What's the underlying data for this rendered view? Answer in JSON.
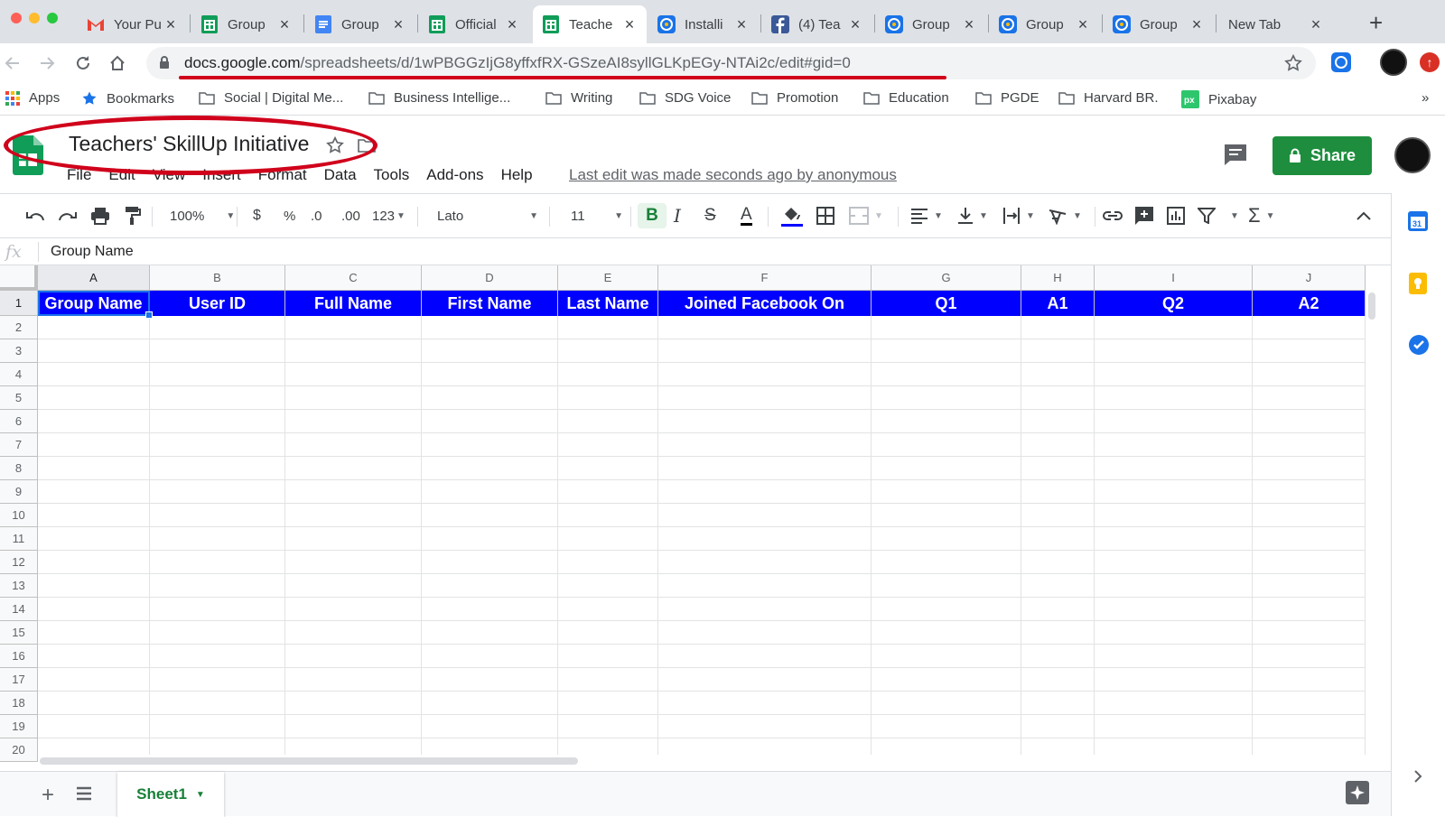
{
  "browser": {
    "tabs": [
      {
        "title": "Your Pu",
        "icon": "gmail-icon"
      },
      {
        "title": "Group",
        "icon": "sheets-icon"
      },
      {
        "title": "Group",
        "icon": "docs-icon"
      },
      {
        "title": "Official",
        "icon": "sheets-icon"
      },
      {
        "title": "Teache",
        "icon": "sheets-icon",
        "active": true
      },
      {
        "title": "Installi",
        "icon": "extension-icon"
      },
      {
        "title": "(4) Tea",
        "icon": "facebook-icon"
      },
      {
        "title": "Group",
        "icon": "extension-icon"
      },
      {
        "title": "Group",
        "icon": "extension-icon"
      },
      {
        "title": "Group",
        "icon": "extension-icon"
      },
      {
        "title": "New Tab",
        "icon": "none"
      }
    ],
    "url_domain": "docs.google.com",
    "url_path": "/spreadsheets/d/1wPBGGzIjG8yffxfRX-GSzeAI8syllGLKpEGy-NTAi2c/edit#gid=0",
    "bookmarks": [
      {
        "label": "Apps",
        "icon": "apps-grid-icon"
      },
      {
        "label": "Bookmarks",
        "icon": "star-icon"
      },
      {
        "label": "Social | Digital Me...",
        "icon": "folder-icon"
      },
      {
        "label": "Business Intellige...",
        "icon": "folder-icon"
      },
      {
        "label": "Writing",
        "icon": "folder-icon"
      },
      {
        "label": "SDG Voice",
        "icon": "folder-icon"
      },
      {
        "label": "Promotion",
        "icon": "folder-icon"
      },
      {
        "label": "Education",
        "icon": "folder-icon"
      },
      {
        "label": "PGDE",
        "icon": "folder-icon"
      },
      {
        "label": "Harvard BR.",
        "icon": "folder-icon"
      },
      {
        "label": "Pixabay",
        "icon": "pixabay-icon"
      }
    ],
    "more_bookmarks": "»"
  },
  "sheets": {
    "doc_title": "Teachers' SkillUp Initiative",
    "menu": [
      "File",
      "Edit",
      "View",
      "Insert",
      "Format",
      "Data",
      "Tools",
      "Add-ons",
      "Help"
    ],
    "last_edit": "Last edit was made seconds ago by anonymous",
    "share_label": "Share",
    "toolbar": {
      "zoom": "100%",
      "currency": "$",
      "percent": "%",
      "dec_decrease": ".0",
      "dec_increase": ".00",
      "more_formats": "123",
      "font": "Lato",
      "font_size": "11"
    },
    "formula_bar": {
      "fx": "fx",
      "value": "Group Name"
    },
    "columns": [
      "A",
      "B",
      "C",
      "D",
      "E",
      "F",
      "G",
      "H",
      "I",
      "J"
    ],
    "rows": [
      "1",
      "2",
      "3",
      "4",
      "5",
      "6",
      "7",
      "8",
      "9",
      "10",
      "11",
      "12",
      "13",
      "14",
      "15",
      "16",
      "17",
      "18",
      "19",
      "20"
    ],
    "header_row": [
      "Group Name",
      "User ID",
      "Full Name",
      "First Name",
      "Last Name",
      "Joined Facebook On",
      "Q1",
      "A1",
      "Q2",
      "A2"
    ],
    "header_fill": "#0000ff",
    "sheet_tab": "Sheet1",
    "accent": "#1e8e3e"
  },
  "annotations": {
    "color": "#d0021b"
  }
}
